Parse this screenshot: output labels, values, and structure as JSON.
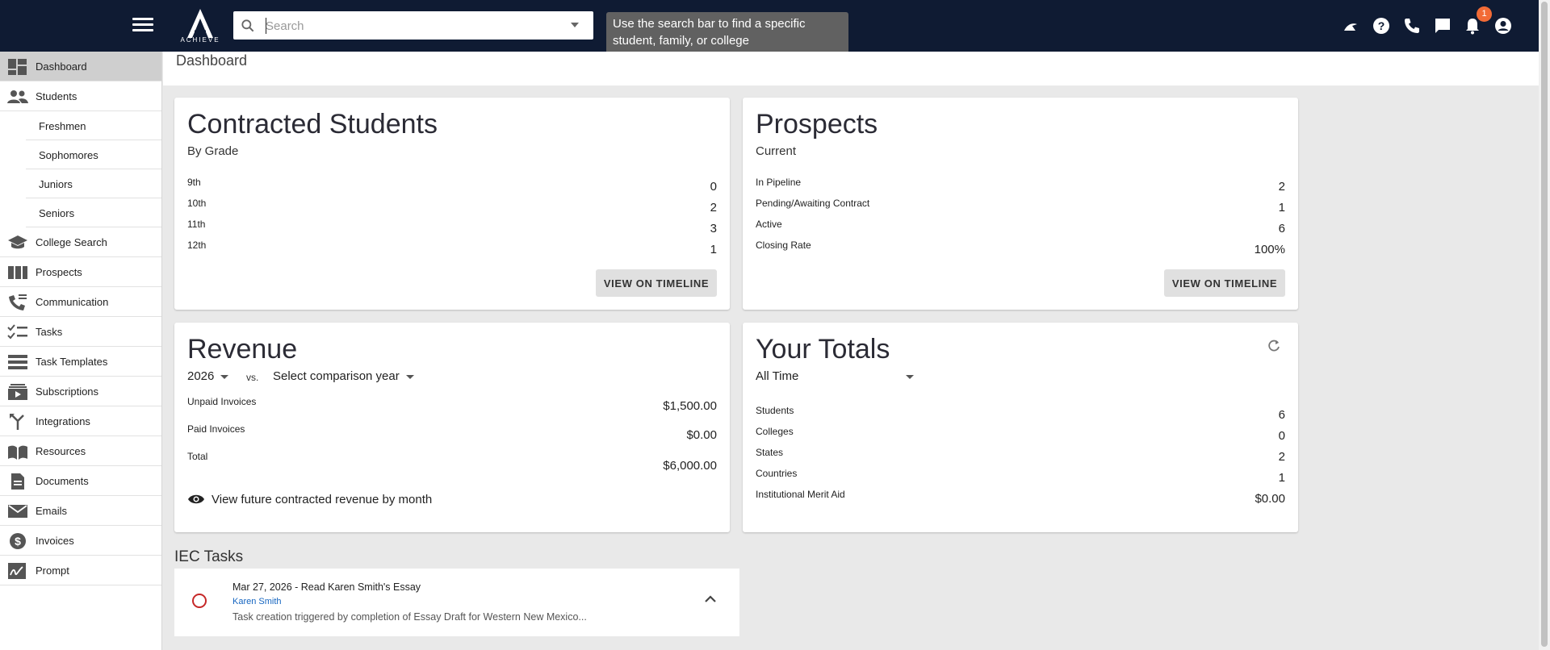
{
  "topbar": {
    "logo_text": "ACHIEVE",
    "search_placeholder": "Search",
    "tooltip": "Use the search bar to find a specific student, family, or college",
    "notification_count": "1"
  },
  "sidebar": {
    "items": [
      {
        "label": "Dashboard",
        "icon": "dashboard-icon"
      },
      {
        "label": "Students",
        "icon": "people-icon"
      },
      {
        "label": "Freshmen"
      },
      {
        "label": "Sophomores"
      },
      {
        "label": "Juniors"
      },
      {
        "label": "Seniors"
      },
      {
        "label": "College Search",
        "icon": "school-icon"
      },
      {
        "label": "Prospects",
        "icon": "columns-icon"
      },
      {
        "label": "Communication",
        "icon": "communication-icon"
      },
      {
        "label": "Tasks",
        "icon": "checklist-icon"
      },
      {
        "label": "Task Templates",
        "icon": "templates-icon"
      },
      {
        "label": "Subscriptions",
        "icon": "subscriptions-icon"
      },
      {
        "label": "Integrations",
        "icon": "merge-icon"
      },
      {
        "label": "Resources",
        "icon": "book-icon"
      },
      {
        "label": "Documents",
        "icon": "document-icon"
      },
      {
        "label": "Emails",
        "icon": "mail-icon"
      },
      {
        "label": "Invoices",
        "icon": "dollar-icon"
      },
      {
        "label": "Prompt",
        "icon": "signature-icon"
      }
    ]
  },
  "page": {
    "title": "Dashboard"
  },
  "contracted": {
    "title": "Contracted Students",
    "subtitle": "By Grade",
    "rows": [
      {
        "label": "9th",
        "value": "0"
      },
      {
        "label": "10th",
        "value": "2"
      },
      {
        "label": "11th",
        "value": "3"
      },
      {
        "label": "12th",
        "value": "1"
      }
    ],
    "button": "VIEW ON TIMELINE"
  },
  "prospects": {
    "title": "Prospects",
    "subtitle": "Current",
    "rows": [
      {
        "label": "In Pipeline",
        "value": "2"
      },
      {
        "label": "Pending/Awaiting Contract",
        "value": "1"
      },
      {
        "label": "Active",
        "value": "6"
      },
      {
        "label": "Closing Rate",
        "value": "100%"
      }
    ],
    "button": "VIEW ON TIMELINE"
  },
  "revenue": {
    "title": "Revenue",
    "year": "2026",
    "vs": "vs.",
    "comparison": "Select comparison year",
    "rows": [
      {
        "label": "Unpaid Invoices",
        "value": "$1,500.00"
      },
      {
        "label": "Paid Invoices",
        "value": "$0.00"
      },
      {
        "label": "Total",
        "value": "$6,000.00"
      }
    ],
    "link": "View future contracted revenue by month"
  },
  "totals": {
    "title": "Your Totals",
    "period": "All Time",
    "rows": [
      {
        "label": "Students",
        "value": "6"
      },
      {
        "label": "Colleges",
        "value": "0"
      },
      {
        "label": "States",
        "value": "2"
      },
      {
        "label": "Countries",
        "value": "1"
      },
      {
        "label": "Institutional Merit Aid",
        "value": "$0.00"
      }
    ]
  },
  "tasks": {
    "title": "IEC Tasks",
    "items": [
      {
        "title": "Mar 27, 2026 - Read Karen Smith's Essay",
        "student": "Karen Smith",
        "description": "Task creation triggered by completion of Essay Draft for Western New Mexico..."
      }
    ]
  }
}
